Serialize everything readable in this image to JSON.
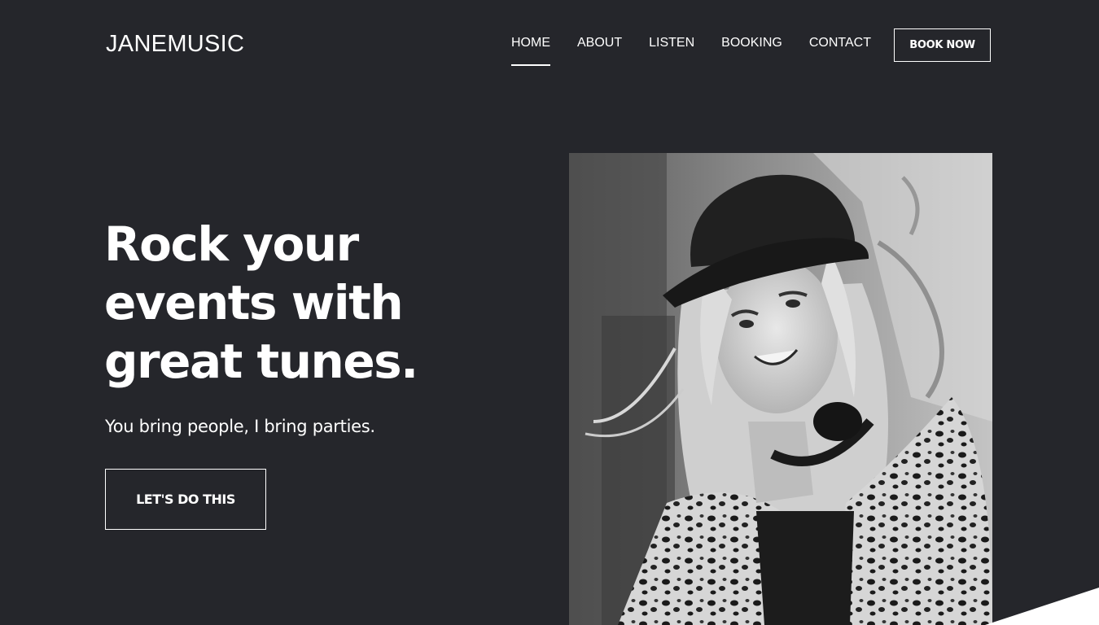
{
  "header": {
    "logo": "JANEMUSIC",
    "nav": [
      "HOME",
      "ABOUT",
      "LISTEN",
      "BOOKING",
      "CONTACT"
    ],
    "active_nav": "HOME",
    "book_now": "BOOK NOW"
  },
  "hero": {
    "headline_lines": [
      "Rock your",
      "events with",
      "great tunes."
    ],
    "subheadline": "You bring people, I bring parties.",
    "cta": "LET'S DO THIS"
  },
  "colors": {
    "background": "#25262b",
    "text": "#ffffff"
  }
}
